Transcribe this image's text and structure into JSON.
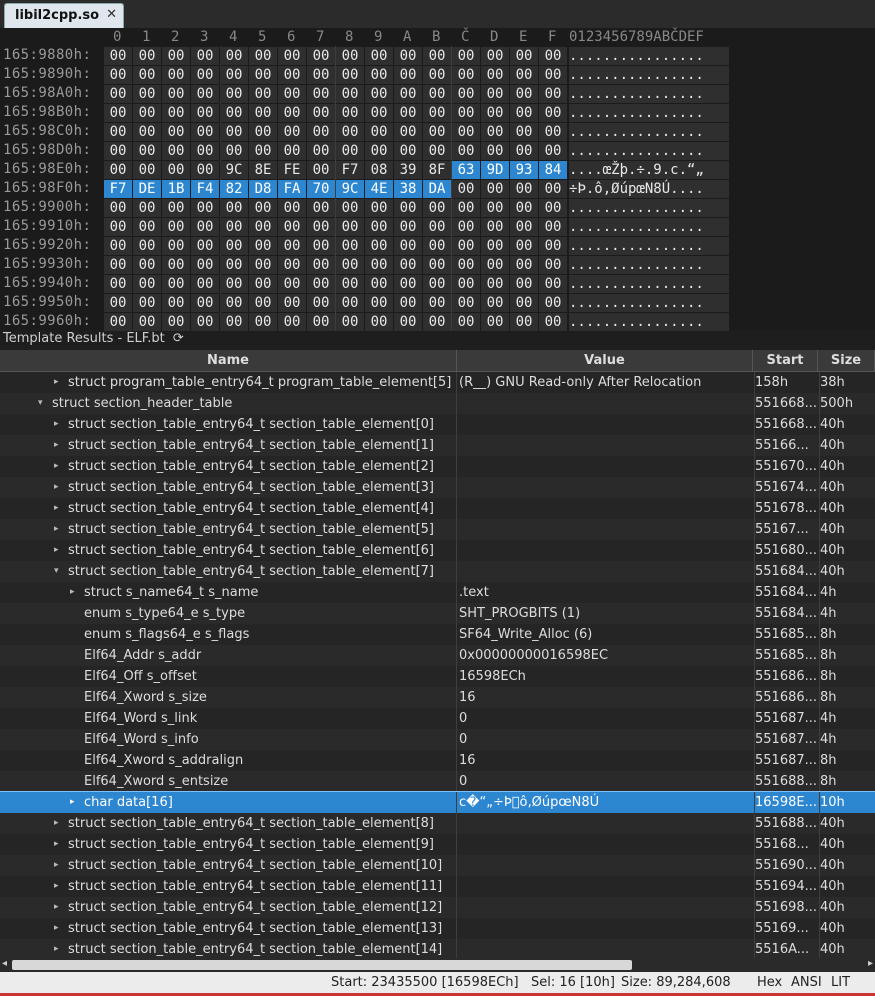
{
  "tab": {
    "title": "libil2cpp.so",
    "close": "✕"
  },
  "hex": {
    "col_headers": [
      "0",
      "1",
      "2",
      "3",
      "4",
      "5",
      "6",
      "7",
      "8",
      "9",
      "A",
      "B",
      "Č",
      "D",
      "E",
      "F"
    ],
    "ascii_header": "0123456789ABČDEF",
    "rows": [
      {
        "addr": "165:9880h:",
        "bytes": [
          "00",
          "00",
          "00",
          "00",
          "00",
          "00",
          "00",
          "00",
          "00",
          "00",
          "00",
          "00",
          "00",
          "00",
          "00",
          "00"
        ],
        "ascii": "................"
      },
      {
        "addr": "165:9890h:",
        "bytes": [
          "00",
          "00",
          "00",
          "00",
          "00",
          "00",
          "00",
          "00",
          "00",
          "00",
          "00",
          "00",
          "00",
          "00",
          "00",
          "00"
        ],
        "ascii": "................"
      },
      {
        "addr": "165:98A0h:",
        "bytes": [
          "00",
          "00",
          "00",
          "00",
          "00",
          "00",
          "00",
          "00",
          "00",
          "00",
          "00",
          "00",
          "00",
          "00",
          "00",
          "00"
        ],
        "ascii": "................"
      },
      {
        "addr": "165:98B0h:",
        "bytes": [
          "00",
          "00",
          "00",
          "00",
          "00",
          "00",
          "00",
          "00",
          "00",
          "00",
          "00",
          "00",
          "00",
          "00",
          "00",
          "00"
        ],
        "ascii": "................"
      },
      {
        "addr": "165:98C0h:",
        "bytes": [
          "00",
          "00",
          "00",
          "00",
          "00",
          "00",
          "00",
          "00",
          "00",
          "00",
          "00",
          "00",
          "00",
          "00",
          "00",
          "00"
        ],
        "ascii": "................"
      },
      {
        "addr": "165:98D0h:",
        "bytes": [
          "00",
          "00",
          "00",
          "00",
          "00",
          "00",
          "00",
          "00",
          "00",
          "00",
          "00",
          "00",
          "00",
          "00",
          "00",
          "00"
        ],
        "ascii": "................"
      },
      {
        "addr": "165:98E0h:",
        "bytes": [
          "00",
          "00",
          "00",
          "00",
          "9C",
          "8E",
          "FE",
          "00",
          "F7",
          "08",
          "39",
          "8F",
          "63",
          "9D",
          "93",
          "84"
        ],
        "ascii": "....œŽþ.÷.9.c.“„"
      },
      {
        "addr": "165:98F0h:",
        "bytes": [
          "F7",
          "DE",
          "1B",
          "F4",
          "82",
          "D8",
          "FA",
          "70",
          "9C",
          "4E",
          "38",
          "DA",
          "00",
          "00",
          "00",
          "00"
        ],
        "ascii": "÷Þ.ô‚ØúpœN8Ú...."
      },
      {
        "addr": "165:9900h:",
        "bytes": [
          "00",
          "00",
          "00",
          "00",
          "00",
          "00",
          "00",
          "00",
          "00",
          "00",
          "00",
          "00",
          "00",
          "00",
          "00",
          "00"
        ],
        "ascii": "................"
      },
      {
        "addr": "165:9910h:",
        "bytes": [
          "00",
          "00",
          "00",
          "00",
          "00",
          "00",
          "00",
          "00",
          "00",
          "00",
          "00",
          "00",
          "00",
          "00",
          "00",
          "00"
        ],
        "ascii": "................"
      },
      {
        "addr": "165:9920h:",
        "bytes": [
          "00",
          "00",
          "00",
          "00",
          "00",
          "00",
          "00",
          "00",
          "00",
          "00",
          "00",
          "00",
          "00",
          "00",
          "00",
          "00"
        ],
        "ascii": "................"
      },
      {
        "addr": "165:9930h:",
        "bytes": [
          "00",
          "00",
          "00",
          "00",
          "00",
          "00",
          "00",
          "00",
          "00",
          "00",
          "00",
          "00",
          "00",
          "00",
          "00",
          "00"
        ],
        "ascii": "................"
      },
      {
        "addr": "165:9940h:",
        "bytes": [
          "00",
          "00",
          "00",
          "00",
          "00",
          "00",
          "00",
          "00",
          "00",
          "00",
          "00",
          "00",
          "00",
          "00",
          "00",
          "00"
        ],
        "ascii": "................"
      },
      {
        "addr": "165:9950h:",
        "bytes": [
          "00",
          "00",
          "00",
          "00",
          "00",
          "00",
          "00",
          "00",
          "00",
          "00",
          "00",
          "00",
          "00",
          "00",
          "00",
          "00"
        ],
        "ascii": "................"
      },
      {
        "addr": "165:9960h:",
        "bytes": [
          "00",
          "00",
          "00",
          "00",
          "00",
          "00",
          "00",
          "00",
          "00",
          "00",
          "00",
          "00",
          "00",
          "00",
          "00",
          "00"
        ],
        "ascii": "................"
      }
    ]
  },
  "template": {
    "header": "Template Results - ELF.bt",
    "refresh_icon": "refresh-icon"
  },
  "grid": {
    "columns": {
      "name": "Name",
      "value": "Value",
      "start": "Start",
      "size": "Size"
    },
    "rows": [
      {
        "indent": 1,
        "arrow": "▸",
        "name": "struct program_table_entry64_t program_table_element[5]",
        "value": "(R__) GNU Read-only After Relocation",
        "start": "158h",
        "size": "38h"
      },
      {
        "indent": 0,
        "arrow": "▾",
        "name": "struct section_header_table",
        "value": "",
        "start": "551668...",
        "size": "500h"
      },
      {
        "indent": 1,
        "arrow": "▸",
        "name": "struct section_table_entry64_t section_table_element[0]",
        "value": "",
        "start": "551668...",
        "size": "40h"
      },
      {
        "indent": 1,
        "arrow": "▸",
        "name": "struct section_table_entry64_t section_table_element[1]",
        "value": "",
        "start": "55166...",
        "size": "40h"
      },
      {
        "indent": 1,
        "arrow": "▸",
        "name": "struct section_table_entry64_t section_table_element[2]",
        "value": "",
        "start": "551670...",
        "size": "40h"
      },
      {
        "indent": 1,
        "arrow": "▸",
        "name": "struct section_table_entry64_t section_table_element[3]",
        "value": "",
        "start": "551674...",
        "size": "40h"
      },
      {
        "indent": 1,
        "arrow": "▸",
        "name": "struct section_table_entry64_t section_table_element[4]",
        "value": "",
        "start": "551678...",
        "size": "40h"
      },
      {
        "indent": 1,
        "arrow": "▸",
        "name": "struct section_table_entry64_t section_table_element[5]",
        "value": "",
        "start": "55167...",
        "size": "40h"
      },
      {
        "indent": 1,
        "arrow": "▸",
        "name": "struct section_table_entry64_t section_table_element[6]",
        "value": "",
        "start": "551680...",
        "size": "40h"
      },
      {
        "indent": 1,
        "arrow": "▾",
        "name": "struct section_table_entry64_t section_table_element[7]",
        "value": "",
        "start": "551684...",
        "size": "40h"
      },
      {
        "indent": 2,
        "arrow": "▸",
        "name": "struct s_name64_t s_name",
        "value": ".text",
        "start": "551684...",
        "size": "4h"
      },
      {
        "indent": 2,
        "arrow": "",
        "name": "enum s_type64_e s_type",
        "value": "SHT_PROGBITS (1)",
        "start": "551684...",
        "size": "4h"
      },
      {
        "indent": 2,
        "arrow": "",
        "name": "enum s_flags64_e s_flags",
        "value": "SF64_Write_Alloc (6)",
        "start": "551685...",
        "size": "8h"
      },
      {
        "indent": 2,
        "arrow": "",
        "name": "Elf64_Addr s_addr",
        "value": "0x00000000016598EC",
        "start": "551685...",
        "size": "8h"
      },
      {
        "indent": 2,
        "arrow": "",
        "name": "Elf64_Off s_offset",
        "value": "16598ECh",
        "start": "551686...",
        "size": "8h"
      },
      {
        "indent": 2,
        "arrow": "",
        "name": "Elf64_Xword s_size",
        "value": "16",
        "start": "551686...",
        "size": "8h"
      },
      {
        "indent": 2,
        "arrow": "",
        "name": "Elf64_Word s_link",
        "value": "0",
        "start": "551687...",
        "size": "4h"
      },
      {
        "indent": 2,
        "arrow": "",
        "name": "Elf64_Word s_info",
        "value": "0",
        "start": "551687...",
        "size": "4h"
      },
      {
        "indent": 2,
        "arrow": "",
        "name": "Elf64_Xword s_addralign",
        "value": "16",
        "start": "551687...",
        "size": "8h"
      },
      {
        "indent": 2,
        "arrow": "",
        "name": "Elf64_Xword s_entsize",
        "value": "0",
        "start": "551688...",
        "size": "8h"
      },
      {
        "indent": 2,
        "arrow": "▸",
        "name": "char data[16]",
        "value": "c�“„÷Þ􂁏ô‚ØúpœN8Ú",
        "start": "16598E...",
        "size": "10h",
        "selected": true
      },
      {
        "indent": 1,
        "arrow": "▸",
        "name": "struct section_table_entry64_t section_table_element[8]",
        "value": "",
        "start": "551688...",
        "size": "40h"
      },
      {
        "indent": 1,
        "arrow": "▸",
        "name": "struct section_table_entry64_t section_table_element[9]",
        "value": "",
        "start": "55168...",
        "size": "40h"
      },
      {
        "indent": 1,
        "arrow": "▸",
        "name": "struct section_table_entry64_t section_table_element[10]",
        "value": "",
        "start": "551690...",
        "size": "40h"
      },
      {
        "indent": 1,
        "arrow": "▸",
        "name": "struct section_table_entry64_t section_table_element[11]",
        "value": "",
        "start": "551694...",
        "size": "40h"
      },
      {
        "indent": 1,
        "arrow": "▸",
        "name": "struct section_table_entry64_t section_table_element[12]",
        "value": "",
        "start": "551698...",
        "size": "40h"
      },
      {
        "indent": 1,
        "arrow": "▸",
        "name": "struct section_table_entry64_t section_table_element[13]",
        "value": "",
        "start": "55169...",
        "size": "40h"
      },
      {
        "indent": 1,
        "arrow": "▸",
        "name": "struct section_table_entry64_t section_table_element[14]",
        "value": "",
        "start": "5516A...",
        "size": "40h"
      }
    ]
  },
  "status": {
    "start": "Start: 23435500 [16598ECh]",
    "sel": "Sel: 16 [10h]",
    "size": "Size: 89,284,608",
    "hex": "Hex",
    "ansi": "ANSI",
    "lit": "LIT"
  },
  "colors": {
    "selection": "#2c86d0",
    "background": "#1e1e1e"
  }
}
